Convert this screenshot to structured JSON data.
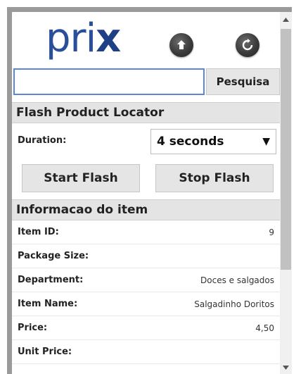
{
  "logo": {
    "prefix": "pri",
    "suffix": "x"
  },
  "header": {
    "home_icon": "home-up-arrow-icon",
    "refresh_icon": "refresh-icon"
  },
  "search": {
    "value": "",
    "placeholder": "",
    "button_label": "Pesquisa"
  },
  "flash_locator": {
    "title": "Flash Product Locator",
    "duration_label": "Duration:",
    "duration_value": "4 seconds",
    "start_label": "Start Flash",
    "stop_label": "Stop Flash"
  },
  "item_info": {
    "title": "Informacao do item",
    "rows": [
      {
        "label": "Item ID:",
        "value": "9"
      },
      {
        "label": "Package Size:",
        "value": ""
      },
      {
        "label": "Department:",
        "value": "Doces e salgados"
      },
      {
        "label": "Item Name:",
        "value": "Salgadinho Doritos"
      },
      {
        "label": "Price:",
        "value": "4,50"
      },
      {
        "label": "Unit Price:",
        "value": ""
      }
    ]
  },
  "colors": {
    "logo": "#2a4f9a",
    "search_border": "#5b87d6",
    "frame": "#9a9a9a"
  }
}
